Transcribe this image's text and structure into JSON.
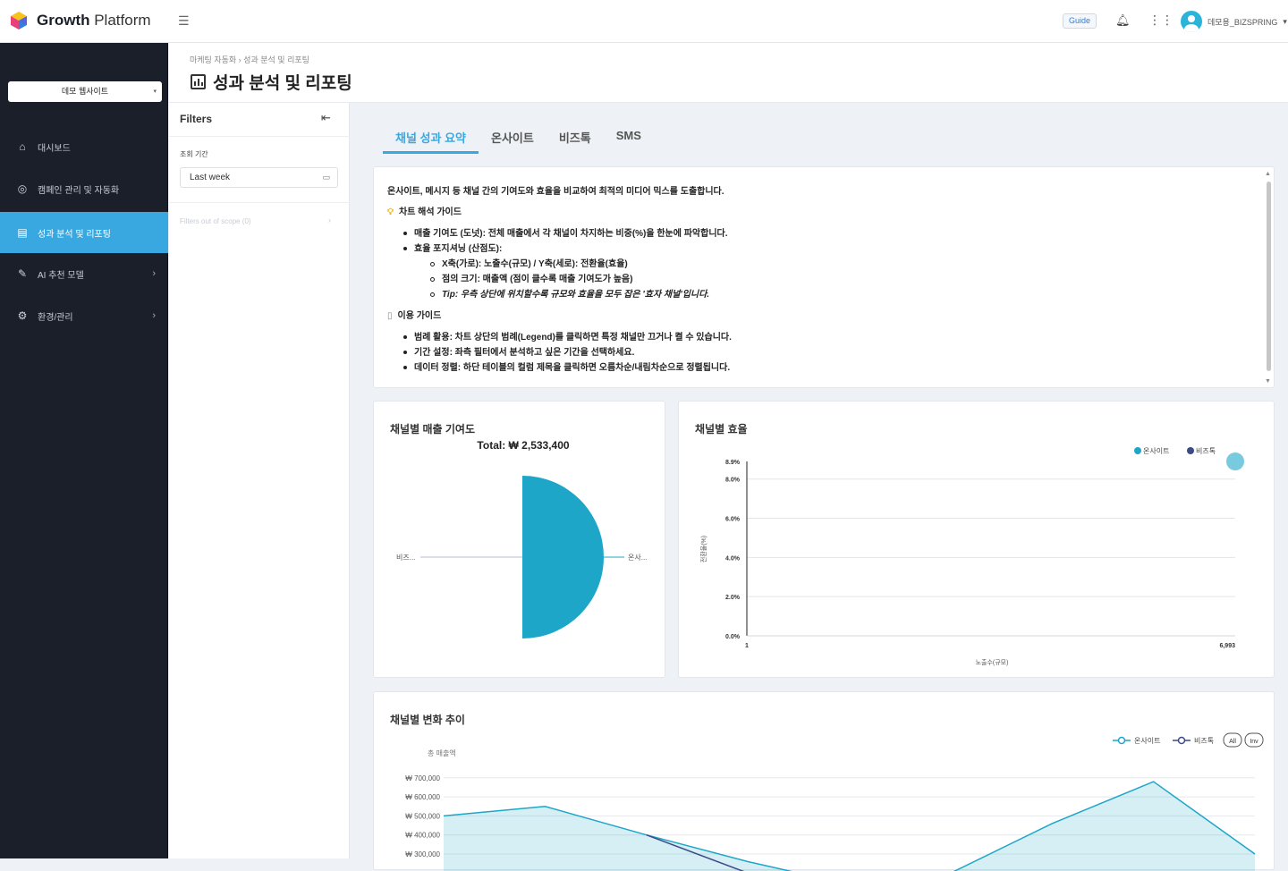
{
  "brand": {
    "name_bold": "Growth",
    "name_light": " Platform"
  },
  "topbar": {
    "guide_label": "Guide",
    "user_name": "데모용_BIZSPRING"
  },
  "sidebar": {
    "site_select": "데모 웹사이트",
    "items": [
      {
        "label": "대시보드",
        "icon": "home-icon"
      },
      {
        "label": "캠페인 관리 및 자동화",
        "icon": "target-icon"
      },
      {
        "label": "성과 분석 및 리포팅",
        "icon": "report-icon",
        "active": true
      },
      {
        "label": "AI 추천 모델",
        "icon": "magic-wand-icon",
        "chevron": true
      },
      {
        "label": "환경/관리",
        "icon": "gear-icon",
        "chevron": true
      }
    ]
  },
  "header": {
    "breadcrumb": "마케팅 자동화  ›  성과 분석 및 리포팅",
    "title": "성과 분석 및 리포팅"
  },
  "filters": {
    "title": "Filters",
    "period_label": "조회 기간",
    "period_value": "Last week",
    "scope_text": "Filters out of scope (0)"
  },
  "tabs": [
    {
      "label": "채널 성과 요약",
      "active": true
    },
    {
      "label": "온사이트"
    },
    {
      "label": "비즈톡"
    },
    {
      "label": "SMS"
    }
  ],
  "info": {
    "intro": "온사이트, 메시지 등 채널 간의 기여도와 효율을 비교하여 최적의 미디어 믹스를 도출합니다.",
    "guide_title": "차트 해석 가이드",
    "b1": "매출 기여도 (도넛): 전체 매출에서 각 채널이 차지하는 비중(%)을 한눈에 파악합니다.",
    "b2": "효율 포지셔닝 (산점도):",
    "s1": "X축(가로): 노출수(규모) / Y축(세로): 전환율(효율)",
    "s2": "점의 크기: 매출액 (점이 클수록 매출 기여도가 높음)",
    "s3": "Tip: 우측 상단에 위치할수록 규모와 효율을 모두 잡은 '효자 채널'입니다.",
    "usage_title": "이용 가이드",
    "u1": "범례 활용: 차트 상단의 범례(Legend)를 클릭하면 특정 채널만 끄거나 켤 수 있습니다.",
    "u2": "기간 설정: 좌측 필터에서 분석하고 싶은 기간을 선택하세요.",
    "u3": "데이터 정렬: 하단 테이블의 컬럼 제목을 클릭하면 오름차순/내림차순으로 정렬됩니다."
  },
  "colors": {
    "accent": "#3aa8e0",
    "onsite": "#1ea6c8",
    "biztalk": "#3c4a86",
    "sidebar": "#1b1f2a"
  },
  "charts": {
    "donut": {
      "title": "채널별 매출 기여도",
      "total": "Total: ₩ 2,533,400",
      "label_left": "비즈...",
      "label_right": "온사..."
    },
    "scatter": {
      "title": "채널별 효율",
      "ylabel": "전환율(%)",
      "xlabel": "노출수(규모)",
      "legend": [
        "온사이트",
        "비즈톡"
      ]
    },
    "trend": {
      "title": "채널별 변화 추이",
      "ylabel": "총 매출액",
      "legend": [
        "온사이트",
        "비즈톡"
      ],
      "btn_all": "All",
      "btn_inv": "Inv"
    }
  },
  "chart_data": [
    {
      "type": "pie",
      "title": "채널별 매출 기여도",
      "subtitle": "Total: ₩ 2,533,400",
      "categories": [
        "온사이트",
        "비즈톡"
      ],
      "values": [
        2533400,
        0
      ]
    },
    {
      "type": "scatter",
      "title": "채널별 효율",
      "xlabel": "노출수(규모)",
      "ylabel": "전환율(%)",
      "xlim": [
        1,
        6993
      ],
      "ylim": [
        0,
        8.9
      ],
      "yticks": [
        "0.0%",
        "2.0%",
        "4.0%",
        "6.0%",
        "8.0%",
        "8.9%"
      ],
      "xticks": [
        "1",
        "6,993"
      ],
      "series": [
        {
          "name": "온사이트",
          "points": [
            {
              "x": 6993,
              "y": 8.9
            }
          ]
        },
        {
          "name": "비즈톡",
          "points": []
        }
      ],
      "legend_position": "top-right",
      "grid": true
    },
    {
      "type": "area",
      "title": "채널별 변화 추이",
      "ylabel": "총 매출액",
      "yticks": [
        "₩ 300,000",
        "₩ 400,000",
        "₩ 500,000",
        "₩ 600,000",
        "₩ 700,000"
      ],
      "series": [
        {
          "name": "온사이트",
          "values": [
            500000,
            550000,
            400000,
            260000,
            140000,
            200000,
            460000,
            680000,
            300000
          ]
        },
        {
          "name": "비즈톡",
          "values": [
            null,
            null,
            400000,
            200000,
            null,
            null,
            null,
            null,
            null
          ]
        }
      ],
      "legend_position": "top-right",
      "grid": true
    }
  ]
}
